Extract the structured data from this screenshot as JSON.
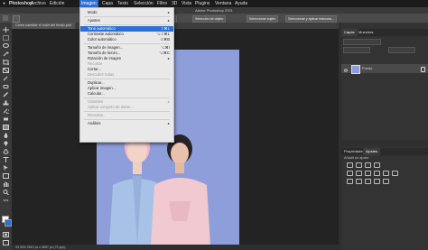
{
  "menubar": {
    "app": "Photoshop",
    "items": [
      "Archivo",
      "Edición",
      "Imagen",
      "Capa",
      "Texto",
      "Selección",
      "Filtro",
      "3D",
      "Vista",
      "Plugins",
      "Ventana",
      "Ayuda"
    ],
    "active": "Imagen"
  },
  "window_title": "Adobe Photoshop 2021",
  "options_bar": {
    "buttons": [
      "Mejorar borde",
      "Selección de objeto",
      "Seleccionar sujeto",
      "Seleccionar y aplicar máscara..."
    ]
  },
  "document_tab": "Cómo cambiar el color del fondo.psd",
  "status_text": "33,33%    2610 px x 3897 px (72 ppp)",
  "image_menu": [
    {
      "label": "Modo",
      "submenu": true
    },
    {
      "sep": true
    },
    {
      "label": "Ajustes",
      "submenu": true
    },
    {
      "sep": true
    },
    {
      "label": "Tono automático",
      "shortcut": "⇧⌘L",
      "selected": true
    },
    {
      "label": "Contraste automático",
      "shortcut": "⌥⇧⌘L"
    },
    {
      "label": "Color automático",
      "shortcut": "⇧⌘B"
    },
    {
      "sep": true
    },
    {
      "label": "Tamaño de imagen...",
      "shortcut": "⌥⌘I"
    },
    {
      "label": "Tamaño de lienzo...",
      "shortcut": "⌥⌘C"
    },
    {
      "label": "Rotación de imagen",
      "submenu": true
    },
    {
      "label": "Recortar",
      "disabled": true
    },
    {
      "label": "Cortar..."
    },
    {
      "label": "Descubrir todas",
      "disabled": true
    },
    {
      "sep": true
    },
    {
      "label": "Duplicar..."
    },
    {
      "label": "Aplicar imagen..."
    },
    {
      "label": "Calcular..."
    },
    {
      "sep": true
    },
    {
      "label": "Variables",
      "submenu": true,
      "disabled": true
    },
    {
      "label": "Aplicar conjunto de datos...",
      "disabled": true
    },
    {
      "sep": true
    },
    {
      "label": "Reventar...",
      "disabled": true
    },
    {
      "sep": true
    },
    {
      "label": "Análisis",
      "submenu": true
    }
  ],
  "layers_panel": {
    "tabs": [
      "Capas",
      "Muestras"
    ],
    "layer_name": "Fondo"
  },
  "adjustments_panel": {
    "tabs": [
      "Propiedades",
      "Ajustes"
    ],
    "subtitle": "Añadir un ajuste"
  },
  "colors": {
    "accent": "#2e6fd3",
    "artboard_bg": "#8e9edb"
  }
}
